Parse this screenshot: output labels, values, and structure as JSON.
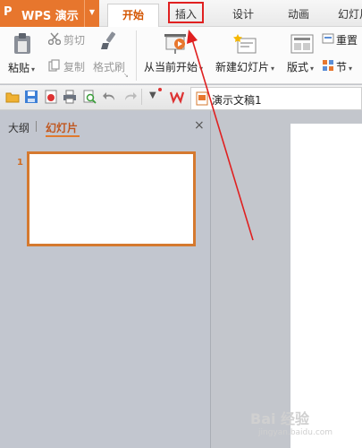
{
  "app": {
    "logo_glyph": "P",
    "name": "WPS 演示",
    "menu_caret": "▼",
    "accent": "#e7762d"
  },
  "tabs": [
    {
      "label": "开始"
    },
    {
      "label": "插入"
    },
    {
      "label": "设计"
    },
    {
      "label": "动画"
    },
    {
      "label": "幻灯片"
    }
  ],
  "ribbon": {
    "paste": "粘贴",
    "cut": "剪切",
    "copy": "复制",
    "format_painter": "格式刷",
    "from_current": "从当前开始",
    "new_slide": "新建幻灯片",
    "layout": "版式",
    "reset": "重置",
    "section": "节"
  },
  "document": {
    "tab_title": "演示文稿1"
  },
  "panel": {
    "outline_tab": "大纲",
    "slides_tab": "幻灯片",
    "close_glyph": "×",
    "slide_number": "1"
  },
  "watermark": {
    "text": "Bai 经验",
    "url": "jingyan.baidu.com"
  },
  "annotation": {
    "color": "#e02020"
  }
}
